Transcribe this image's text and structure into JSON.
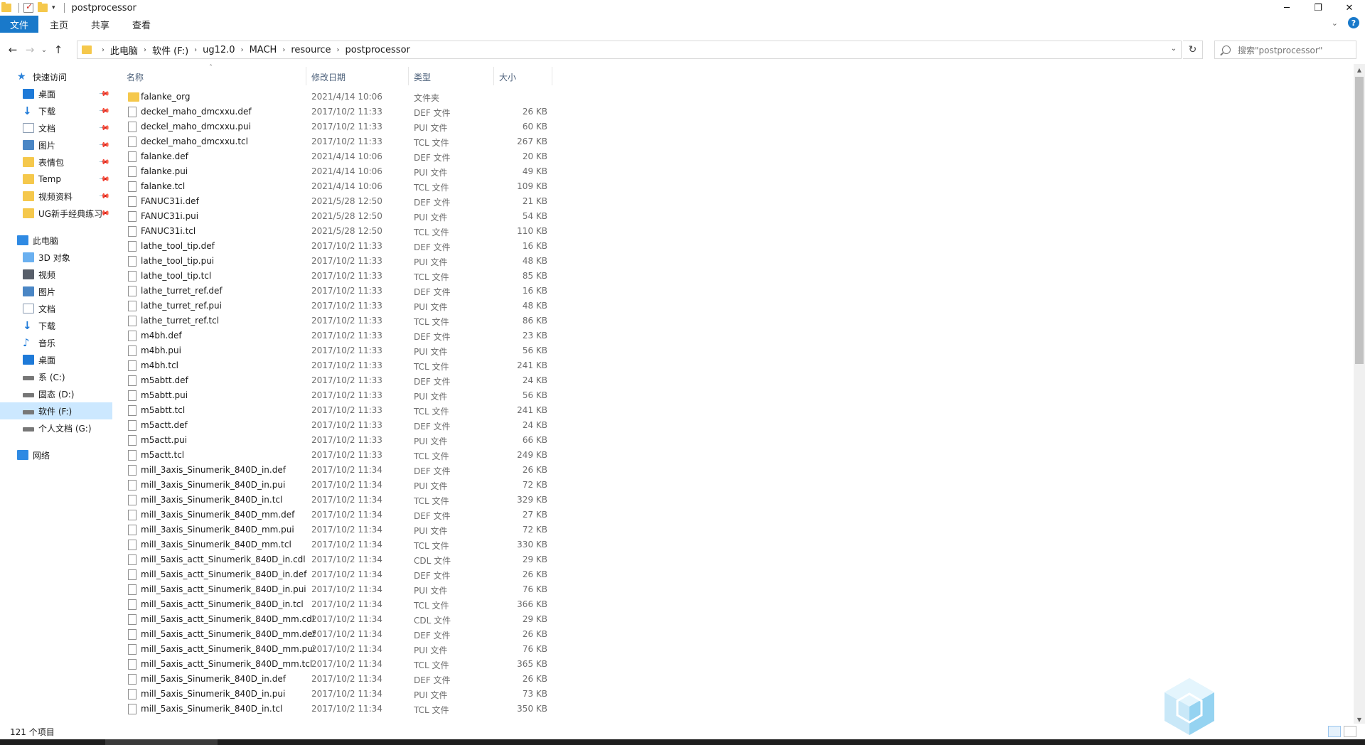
{
  "window": {
    "title": "postprocessor",
    "controls": {
      "minimize": "─",
      "maximize": "❐",
      "close": "✕"
    }
  },
  "ribbon": {
    "tabs": [
      {
        "label": "文件"
      },
      {
        "label": "主页"
      },
      {
        "label": "共享"
      },
      {
        "label": "查看"
      }
    ],
    "help": "?"
  },
  "nav": {
    "back": "←",
    "forward": "→",
    "recent": "⌄",
    "up": "↑",
    "breadcrumbs": [
      "此电脑",
      "软件 (F:)",
      "ug12.0",
      "MACH",
      "resource",
      "postprocessor"
    ],
    "refresh": "↻",
    "search_placeholder": "搜索\"postprocessor\""
  },
  "sidebar": {
    "quick_access": {
      "label": "快速访问",
      "items": [
        {
          "label": "桌面",
          "icon": "desktop-icon"
        },
        {
          "label": "下载",
          "icon": "download-icon"
        },
        {
          "label": "文档",
          "icon": "document-icon"
        },
        {
          "label": "图片",
          "icon": "picture-icon"
        },
        {
          "label": "表情包",
          "icon": "folder-icon"
        },
        {
          "label": "Temp",
          "icon": "folder-icon"
        },
        {
          "label": "视频资料",
          "icon": "folder-icon"
        },
        {
          "label": "UG新手经典练习",
          "icon": "folder-icon"
        }
      ]
    },
    "this_pc": {
      "label": "此电脑",
      "items": [
        {
          "label": "3D 对象",
          "icon": "3d-objects-icon"
        },
        {
          "label": "视频",
          "icon": "video-icon"
        },
        {
          "label": "图片",
          "icon": "picture-icon"
        },
        {
          "label": "文档",
          "icon": "document-icon"
        },
        {
          "label": "下载",
          "icon": "download-icon"
        },
        {
          "label": "音乐",
          "icon": "music-icon"
        },
        {
          "label": "桌面",
          "icon": "desktop-icon"
        },
        {
          "label": "系 (C:)",
          "icon": "drive-icon"
        },
        {
          "label": "固态 (D:)",
          "icon": "drive-icon"
        },
        {
          "label": "软件 (F:)",
          "icon": "drive-icon",
          "selected": true
        },
        {
          "label": "个人文档 (G:)",
          "icon": "drive-icon"
        }
      ]
    },
    "network": {
      "label": "网络"
    }
  },
  "columns": {
    "name": "名称",
    "date": "修改日期",
    "type": "类型",
    "size": "大小"
  },
  "files": [
    {
      "name": "falanke_org",
      "date": "2021/4/14 10:06",
      "type": "文件夹",
      "size": "",
      "folder": true
    },
    {
      "name": "deckel_maho_dmcxxu.def",
      "date": "2017/10/2 11:33",
      "type": "DEF 文件",
      "size": "26 KB"
    },
    {
      "name": "deckel_maho_dmcxxu.pui",
      "date": "2017/10/2 11:33",
      "type": "PUI 文件",
      "size": "60 KB"
    },
    {
      "name": "deckel_maho_dmcxxu.tcl",
      "date": "2017/10/2 11:33",
      "type": "TCL 文件",
      "size": "267 KB"
    },
    {
      "name": "falanke.def",
      "date": "2021/4/14 10:06",
      "type": "DEF 文件",
      "size": "20 KB"
    },
    {
      "name": "falanke.pui",
      "date": "2021/4/14 10:06",
      "type": "PUI 文件",
      "size": "49 KB"
    },
    {
      "name": "falanke.tcl",
      "date": "2021/4/14 10:06",
      "type": "TCL 文件",
      "size": "109 KB"
    },
    {
      "name": "FANUC31i.def",
      "date": "2021/5/28 12:50",
      "type": "DEF 文件",
      "size": "21 KB"
    },
    {
      "name": "FANUC31i.pui",
      "date": "2021/5/28 12:50",
      "type": "PUI 文件",
      "size": "54 KB"
    },
    {
      "name": "FANUC31i.tcl",
      "date": "2021/5/28 12:50",
      "type": "TCL 文件",
      "size": "110 KB"
    },
    {
      "name": "lathe_tool_tip.def",
      "date": "2017/10/2 11:33",
      "type": "DEF 文件",
      "size": "16 KB"
    },
    {
      "name": "lathe_tool_tip.pui",
      "date": "2017/10/2 11:33",
      "type": "PUI 文件",
      "size": "48 KB"
    },
    {
      "name": "lathe_tool_tip.tcl",
      "date": "2017/10/2 11:33",
      "type": "TCL 文件",
      "size": "85 KB"
    },
    {
      "name": "lathe_turret_ref.def",
      "date": "2017/10/2 11:33",
      "type": "DEF 文件",
      "size": "16 KB"
    },
    {
      "name": "lathe_turret_ref.pui",
      "date": "2017/10/2 11:33",
      "type": "PUI 文件",
      "size": "48 KB"
    },
    {
      "name": "lathe_turret_ref.tcl",
      "date": "2017/10/2 11:33",
      "type": "TCL 文件",
      "size": "86 KB"
    },
    {
      "name": "m4bh.def",
      "date": "2017/10/2 11:33",
      "type": "DEF 文件",
      "size": "23 KB"
    },
    {
      "name": "m4bh.pui",
      "date": "2017/10/2 11:33",
      "type": "PUI 文件",
      "size": "56 KB"
    },
    {
      "name": "m4bh.tcl",
      "date": "2017/10/2 11:33",
      "type": "TCL 文件",
      "size": "241 KB"
    },
    {
      "name": "m5abtt.def",
      "date": "2017/10/2 11:33",
      "type": "DEF 文件",
      "size": "24 KB"
    },
    {
      "name": "m5abtt.pui",
      "date": "2017/10/2 11:33",
      "type": "PUI 文件",
      "size": "56 KB"
    },
    {
      "name": "m5abtt.tcl",
      "date": "2017/10/2 11:33",
      "type": "TCL 文件",
      "size": "241 KB"
    },
    {
      "name": "m5actt.def",
      "date": "2017/10/2 11:33",
      "type": "DEF 文件",
      "size": "24 KB"
    },
    {
      "name": "m5actt.pui",
      "date": "2017/10/2 11:33",
      "type": "PUI 文件",
      "size": "66 KB"
    },
    {
      "name": "m5actt.tcl",
      "date": "2017/10/2 11:33",
      "type": "TCL 文件",
      "size": "249 KB"
    },
    {
      "name": "mill_3axis_Sinumerik_840D_in.def",
      "date": "2017/10/2 11:34",
      "type": "DEF 文件",
      "size": "26 KB"
    },
    {
      "name": "mill_3axis_Sinumerik_840D_in.pui",
      "date": "2017/10/2 11:34",
      "type": "PUI 文件",
      "size": "72 KB"
    },
    {
      "name": "mill_3axis_Sinumerik_840D_in.tcl",
      "date": "2017/10/2 11:34",
      "type": "TCL 文件",
      "size": "329 KB"
    },
    {
      "name": "mill_3axis_Sinumerik_840D_mm.def",
      "date": "2017/10/2 11:34",
      "type": "DEF 文件",
      "size": "27 KB"
    },
    {
      "name": "mill_3axis_Sinumerik_840D_mm.pui",
      "date": "2017/10/2 11:34",
      "type": "PUI 文件",
      "size": "72 KB"
    },
    {
      "name": "mill_3axis_Sinumerik_840D_mm.tcl",
      "date": "2017/10/2 11:34",
      "type": "TCL 文件",
      "size": "330 KB"
    },
    {
      "name": "mill_5axis_actt_Sinumerik_840D_in.cdl",
      "date": "2017/10/2 11:34",
      "type": "CDL 文件",
      "size": "29 KB"
    },
    {
      "name": "mill_5axis_actt_Sinumerik_840D_in.def",
      "date": "2017/10/2 11:34",
      "type": "DEF 文件",
      "size": "26 KB"
    },
    {
      "name": "mill_5axis_actt_Sinumerik_840D_in.pui",
      "date": "2017/10/2 11:34",
      "type": "PUI 文件",
      "size": "76 KB"
    },
    {
      "name": "mill_5axis_actt_Sinumerik_840D_in.tcl",
      "date": "2017/10/2 11:34",
      "type": "TCL 文件",
      "size": "366 KB"
    },
    {
      "name": "mill_5axis_actt_Sinumerik_840D_mm.cdl",
      "date": "2017/10/2 11:34",
      "type": "CDL 文件",
      "size": "29 KB"
    },
    {
      "name": "mill_5axis_actt_Sinumerik_840D_mm.def",
      "date": "2017/10/2 11:34",
      "type": "DEF 文件",
      "size": "26 KB"
    },
    {
      "name": "mill_5axis_actt_Sinumerik_840D_mm.pui",
      "date": "2017/10/2 11:34",
      "type": "PUI 文件",
      "size": "76 KB"
    },
    {
      "name": "mill_5axis_actt_Sinumerik_840D_mm.tcl",
      "date": "2017/10/2 11:34",
      "type": "TCL 文件",
      "size": "365 KB"
    },
    {
      "name": "mill_5axis_Sinumerik_840D_in.def",
      "date": "2017/10/2 11:34",
      "type": "DEF 文件",
      "size": "26 KB"
    },
    {
      "name": "mill_5axis_Sinumerik_840D_in.pui",
      "date": "2017/10/2 11:34",
      "type": "PUI 文件",
      "size": "73 KB"
    },
    {
      "name": "mill_5axis_Sinumerik_840D_in.tcl",
      "date": "2017/10/2 11:34",
      "type": "TCL 文件",
      "size": "350 KB"
    }
  ],
  "status": {
    "item_count": "121 个项目"
  },
  "colors": {
    "accent": "#1979ca",
    "folder": "#f5c84c",
    "selection": "#cce8ff"
  }
}
